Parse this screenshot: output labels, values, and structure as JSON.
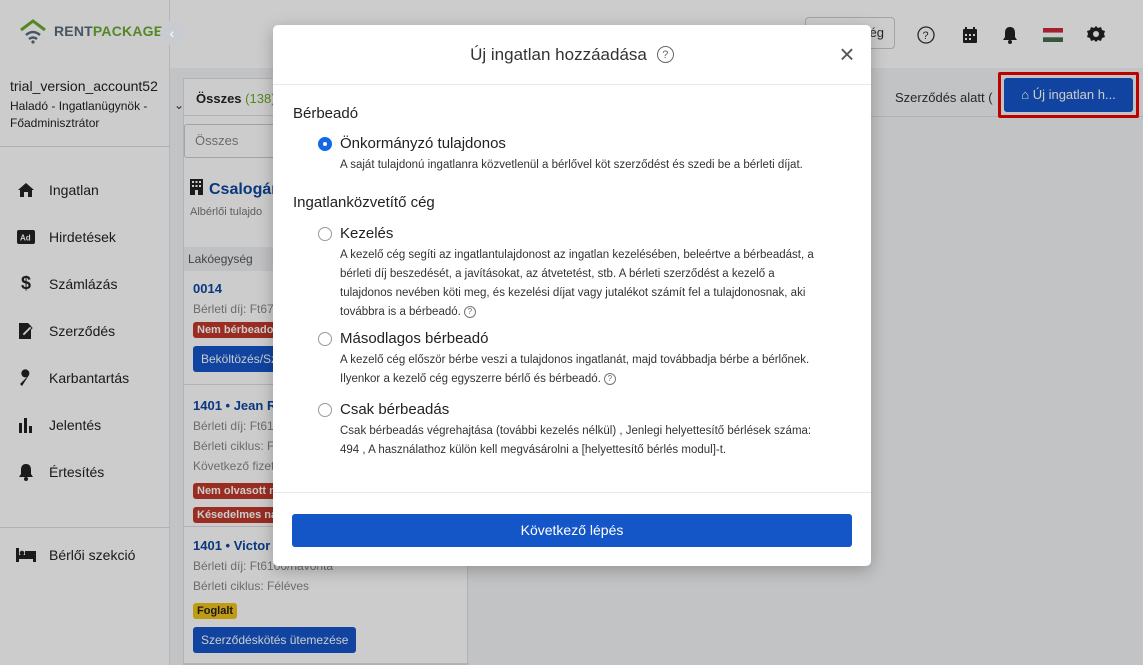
{
  "app": {
    "logo_rent": "RENT",
    "logo_package": "PACKAGE"
  },
  "account": {
    "name": "trial_version_account52",
    "role": "Haladó - Ingatlanügynök - Főadminisztrátor"
  },
  "sidebar": {
    "items": [
      {
        "label": "Ingatlan",
        "icon": "home-icon"
      },
      {
        "label": "Hirdetések",
        "icon": "ad-icon"
      },
      {
        "label": "Számlázás",
        "icon": "dollar-icon"
      },
      {
        "label": "Szerződés",
        "icon": "contract-icon"
      },
      {
        "label": "Karbantartás",
        "icon": "wrench-icon"
      },
      {
        "label": "Jelentés",
        "icon": "bar-chart-icon"
      },
      {
        "label": "Értesítés",
        "icon": "bell-icon"
      }
    ],
    "bottom_item": {
      "label": "Bérlői szekció",
      "icon": "bed-icon"
    }
  },
  "topbar": {
    "search_button": "ég"
  },
  "list": {
    "tab_all_label": "Összes",
    "tab_all_count": "(138)",
    "filter_value": "Összes",
    "property_title": "Csalogán",
    "property_sub": "Albérlői tulajdo",
    "unit_header": "Lakóegység",
    "units": [
      {
        "title": "0014",
        "meta": [
          "Bérleti díj: Ft67"
        ],
        "badges": [
          "Nem bérbeadott"
        ],
        "button": "Beköltözés/Sz"
      },
      {
        "title": "1401 • Jean R",
        "meta": [
          "Bérleti díj: Ft61",
          "Bérleti ciklus: F",
          "Következő fizet"
        ],
        "badges": [
          "Nem olvasott m",
          "Késedelmes nap"
        ]
      },
      {
        "title": "1401 • Victor",
        "meta": [
          "Bérleti díj: Ft6100/havonta",
          "Bérleti ciklus: Féléves"
        ],
        "badges": [
          "Foglalt"
        ],
        "button": "Szerződéskötés ütemezése"
      }
    ]
  },
  "right": {
    "contract_tab": "Szerződés alatt (",
    "new_property_button": "Új ingatlan h..."
  },
  "modal": {
    "title": "Új ingatlan hozzáadása",
    "sections": [
      {
        "heading": "Bérbeadó",
        "options": [
          {
            "label": "Önkormányzó tulajdonos",
            "checked": true,
            "desc": "A saját tulajdonú ingatlanra közvetlenül a bérlővel köt szerződést és szedi be a bérleti díjat."
          }
        ]
      },
      {
        "heading": "Ingatlanközvetítő cég",
        "options": [
          {
            "label": "Kezelés",
            "checked": false,
            "desc": "A kezelő cég segíti az ingatlantulajdonost az ingatlan kezelésében, beleértve a bérbeadást, a bérleti díj beszedését, a javításokat, az átvetetést, stb. A bérleti szerződést a kezelő a tulajdonos nevében köti meg, és kezelési díjat vagy jutalékot számít fel a tulajdonosnak, aki továbbra is a bérbeadó."
          },
          {
            "label": "Másodlagos bérbeadó",
            "checked": false,
            "desc": "A kezelő cég először bérbe veszi a tulajdonos ingatlanát, majd továbbadja bérbe a bérlőnek. Ilyenkor a kezelő cég egyszerre bérlő és bérbeadó."
          },
          {
            "label": "Csak bérbeadás",
            "checked": false,
            "desc": "Csak bérbeadás végrehajtása (további kezelés nélkül) , Jenlegi helyettesítő bérlések száma: 494 , A használathoz külön kell megvásárolni a [helyettesítő bérlés modul]-t."
          }
        ]
      }
    ],
    "next_button": "Következő lépés"
  },
  "colors": {
    "primary": "#1456c8",
    "brand_green": "#6aab2e",
    "highlight_red": "#ee0000"
  }
}
